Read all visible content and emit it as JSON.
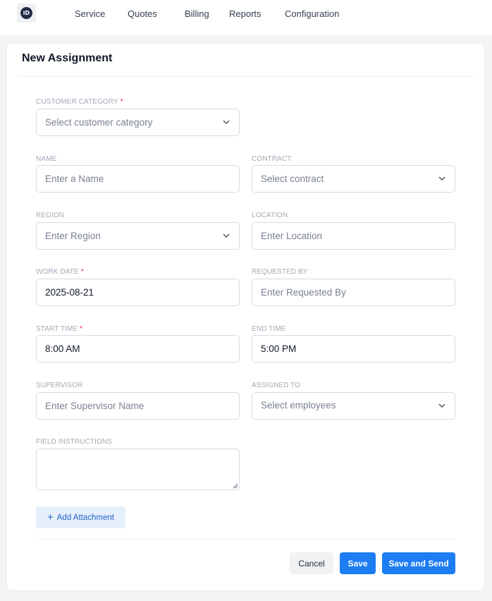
{
  "logo": {
    "text": "iD"
  },
  "nav": {
    "items": [
      {
        "label": "Service"
      },
      {
        "label": "Quotes"
      },
      {
        "label": "Billing"
      },
      {
        "label": "Reports"
      },
      {
        "label": "Configuration"
      }
    ]
  },
  "form": {
    "title": "New Assignment",
    "required_mark": "*",
    "customer_category": {
      "label": "CUSTOMER CATEGORY",
      "placeholder": "Select customer category"
    },
    "name": {
      "label": "NAME",
      "placeholder": "Enter a Name"
    },
    "contract": {
      "label": "CONTRACT",
      "placeholder": "Select contract"
    },
    "region": {
      "label": "REGION",
      "placeholder": "Enter Region"
    },
    "location": {
      "label": "LOCATION",
      "placeholder": "Enter Location"
    },
    "work_date": {
      "label": "WORK DATE",
      "value": "2025-08-21"
    },
    "requested_by": {
      "label": "REQUESTED BY",
      "placeholder": "Enter Requested By"
    },
    "start_time": {
      "label": "START TIME",
      "value": "8:00 AM"
    },
    "end_time": {
      "label": "END TIME",
      "value": "5:00 PM"
    },
    "supervisor": {
      "label": "SUPERVISOR",
      "placeholder": "Enter Supervisor Name"
    },
    "assigned_to": {
      "label": "ASSIGNED TO",
      "placeholder": "Select employees"
    },
    "field_instructions": {
      "label": "FIELD INSTRUCTIONS",
      "value": ""
    },
    "add_attachment": {
      "icon": "+",
      "label": "Add Attachment"
    }
  },
  "actions": {
    "cancel_label": "Cancel",
    "save_label": "Save",
    "save_send_label": "Save and Send"
  },
  "colors": {
    "primary": "#1d7df2",
    "required": "#e11d48",
    "attach_bg": "#e6f0fc"
  }
}
